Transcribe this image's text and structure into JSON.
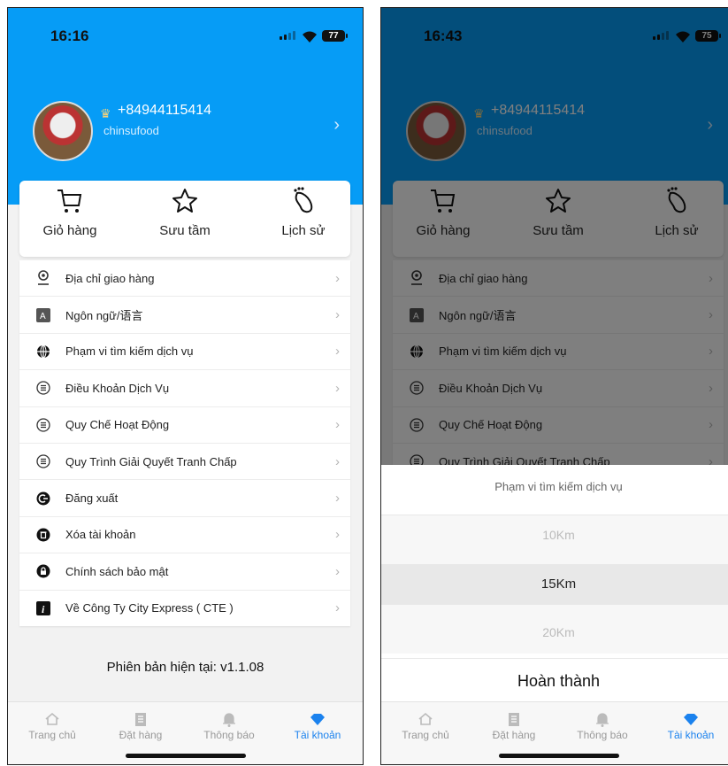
{
  "left": {
    "status": {
      "time": "16:16",
      "battery": "77"
    },
    "profile": {
      "phone": "+84944115414",
      "username": "chinsufood"
    },
    "quick": [
      {
        "label": "Giỏ hàng",
        "icon": "cart-icon"
      },
      {
        "label": "Sưu tầm",
        "icon": "star-icon"
      },
      {
        "label": "Lịch sử",
        "icon": "footprint-icon"
      }
    ],
    "menu": [
      {
        "label": "Địa chỉ giao hàng",
        "icon": "location-pin-icon"
      },
      {
        "label": "Ngôn ngữ/语言",
        "icon": "language-icon"
      },
      {
        "label": "Phạm vi tìm kiếm dịch vụ",
        "icon": "globe-icon"
      },
      {
        "label": "Điều Khoản Dịch Vụ",
        "icon": "list-icon"
      },
      {
        "label": "Quy Chế Hoạt Động",
        "icon": "list-icon"
      },
      {
        "label": "Quy Trình Giải Quyết Tranh Chấp",
        "icon": "list-icon"
      },
      {
        "label": "Đăng xuất",
        "icon": "logout-icon"
      },
      {
        "label": "Xóa tài khoản",
        "icon": "trash-icon"
      },
      {
        "label": "Chính sách bảo mật",
        "icon": "lock-icon"
      },
      {
        "label": "Về Công Ty City Express ( CTE )",
        "icon": "info-icon"
      }
    ],
    "version": "Phiên bản hiện tại: v1.1.08",
    "tabs": [
      {
        "label": "Trang chủ",
        "icon": "home-icon"
      },
      {
        "label": "Đặt hàng",
        "icon": "order-icon"
      },
      {
        "label": "Thông báo",
        "icon": "bell-icon"
      },
      {
        "label": "Tài khoản",
        "icon": "diamond-icon",
        "active": true
      }
    ]
  },
  "right": {
    "status": {
      "time": "16:43",
      "battery": "75"
    },
    "picker": {
      "title": "Phạm vi tìm kiếm dịch vụ",
      "options": [
        "10Km",
        "15Km",
        "20Km"
      ],
      "selected": "15Km",
      "done_label": "Hoàn thành"
    }
  },
  "colors": {
    "header_blue": "#069cf6",
    "active_tab": "#1b82ee"
  }
}
